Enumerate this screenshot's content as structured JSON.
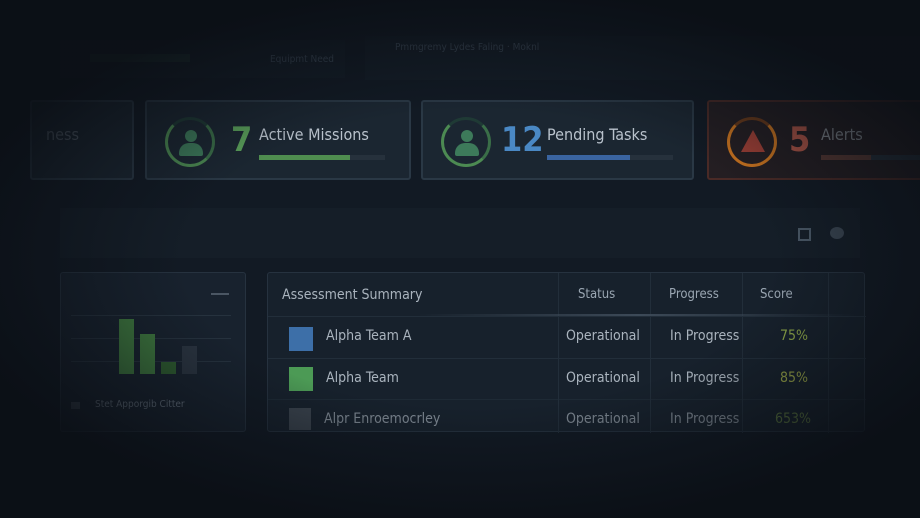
{
  "top": {
    "equipment_label": "Equipmt Need",
    "header_text": "Pmmgremy Lydes Faling · Moknl"
  },
  "cards": [
    {
      "number": "",
      "label": "ness"
    },
    {
      "number": "7",
      "label": "Active Missions",
      "icon": "user-icon",
      "color": "#5aa05a",
      "progress": 0.72
    },
    {
      "number": "12",
      "label": "Pending Tasks",
      "icon": "user-icon",
      "color": "#4a88c4",
      "progress": 0.66
    },
    {
      "number": "5",
      "label": "Alerts",
      "icon": "warning-icon",
      "color": "#c0543f",
      "progress": 0.4
    }
  ],
  "chart": {
    "legend": "Stet Apporgib Citter",
    "values": [
      55,
      40,
      12,
      28
    ],
    "colors": [
      "#3f7a3f",
      "#3f7a3f",
      "#2f5f30",
      "#2a3440"
    ]
  },
  "table": {
    "title": "Assessment Summary",
    "columns": [
      "Status",
      "Progress",
      "Score"
    ],
    "rows": [
      {
        "name": "Alpha Team A",
        "status": "Operational",
        "progress": "In Progress",
        "score": "75%",
        "icon": "building-icon",
        "icon_color": "#3d6fa8"
      },
      {
        "name": "Alpha Team",
        "status": "Operational",
        "progress": "In Progress",
        "score": "85%",
        "icon": "person-icon",
        "icon_color": "#4c9a55"
      },
      {
        "name": "Alpr Enroemocrley",
        "status": "Operational",
        "progress": "In Progress",
        "score": "653%",
        "icon": "building-icon",
        "icon_color": "#4a525c"
      }
    ]
  }
}
